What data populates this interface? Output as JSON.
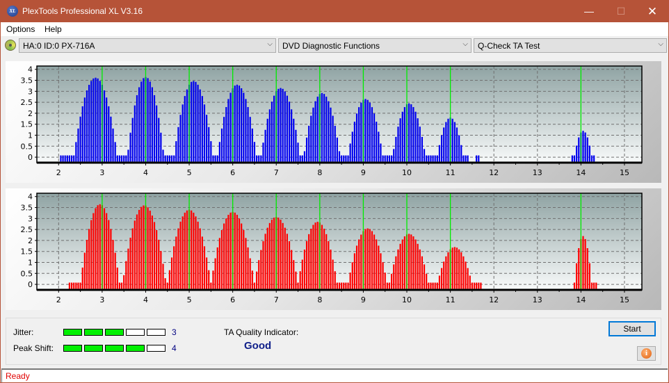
{
  "window": {
    "title": "PlexTools Professional XL V3.16",
    "app_icon_text": "XL",
    "controls": {
      "minimize": "—",
      "maximize": "☐",
      "close": "✕"
    }
  },
  "menu": {
    "items": [
      "Options",
      "Help"
    ]
  },
  "toolbar": {
    "drive": "HA:0 ID:0  PX-716A",
    "function_group": "DVD Diagnostic Functions",
    "test": "Q-Check TA Test",
    "arrow": "⌵"
  },
  "colors": {
    "titlebar": "#b65338",
    "jitter_bar": "#0000ee",
    "peak_shift_bar": "#ff0000",
    "marker_line": "#00ee00",
    "meter_on": "#00f000",
    "quality_text": "#10208a",
    "status_text": "#e00000"
  },
  "chart_data": [
    {
      "type": "bar",
      "name": "Jitter distribution (lands)",
      "color": "#0000ee",
      "xlim": [
        1.5,
        15.4
      ],
      "ylim": [
        -0.25,
        4.15
      ],
      "xticks": [
        2,
        3,
        4,
        5,
        6,
        7,
        8,
        9,
        10,
        11,
        12,
        13,
        14,
        15
      ],
      "yticks": [
        0,
        0.5,
        1,
        1.5,
        2,
        2.5,
        3,
        3.5,
        4
      ],
      "ytick_labels": [
        "0",
        "0.5",
        "1",
        "1.5",
        "2",
        "2.5",
        "3",
        "3.5",
        "4"
      ],
      "marker_lines": [
        3,
        4,
        5,
        6,
        7,
        8,
        9,
        10,
        11,
        14
      ],
      "grid": true,
      "peaks": [
        {
          "center": 2.85,
          "height": 3.62,
          "width": 0.5
        },
        {
          "center": 4.0,
          "height": 3.65,
          "width": 0.42
        },
        {
          "center": 5.1,
          "height": 3.47,
          "width": 0.45
        },
        {
          "center": 6.1,
          "height": 3.3,
          "width": 0.45
        },
        {
          "center": 7.1,
          "height": 3.15,
          "width": 0.45
        },
        {
          "center": 8.05,
          "height": 2.92,
          "width": 0.42
        },
        {
          "center": 9.05,
          "height": 2.65,
          "width": 0.4
        },
        {
          "center": 10.05,
          "height": 2.45,
          "width": 0.38
        },
        {
          "center": 11.0,
          "height": 1.8,
          "width": 0.3
        },
        {
          "center": 14.05,
          "height": 1.2,
          "width": 0.2
        }
      ],
      "x_range_with_bars": [
        [
          2.05,
          11.4
        ],
        [
          11.6,
          11.65
        ],
        [
          13.8,
          14.3
        ]
      ]
    },
    {
      "type": "bar",
      "name": "Peak shift distribution (pits)",
      "color": "#ff0000",
      "xlim": [
        1.5,
        15.4
      ],
      "ylim": [
        -0.25,
        4.15
      ],
      "xticks": [
        2,
        3,
        4,
        5,
        6,
        7,
        8,
        9,
        10,
        11,
        12,
        13,
        14,
        15
      ],
      "yticks": [
        0,
        0.5,
        1,
        1.5,
        2,
        2.5,
        3,
        3.5,
        4
      ],
      "ytick_labels": [
        "0",
        "0.5",
        "1",
        "1.5",
        "2",
        "2.5",
        "3",
        "3.5",
        "4"
      ],
      "marker_lines": [
        3,
        4,
        5,
        6,
        7,
        8,
        9,
        10,
        11,
        14
      ],
      "grid": true,
      "peaks": [
        {
          "center": 2.95,
          "height": 3.65,
          "width": 0.45
        },
        {
          "center": 3.97,
          "height": 3.6,
          "width": 0.5
        },
        {
          "center": 5.0,
          "height": 3.4,
          "width": 0.5
        },
        {
          "center": 6.0,
          "height": 3.3,
          "width": 0.5
        },
        {
          "center": 7.0,
          "height": 3.07,
          "width": 0.5
        },
        {
          "center": 7.95,
          "height": 2.85,
          "width": 0.45
        },
        {
          "center": 9.1,
          "height": 2.55,
          "width": 0.45
        },
        {
          "center": 10.05,
          "height": 2.3,
          "width": 0.45
        },
        {
          "center": 11.1,
          "height": 1.7,
          "width": 0.4
        },
        {
          "center": 14.05,
          "height": 2.2,
          "width": 0.2
        }
      ],
      "x_range_with_bars": [
        [
          2.25,
          11.7
        ],
        [
          13.85,
          14.35
        ]
      ]
    }
  ],
  "metrics": {
    "jitter": {
      "label": "Jitter:",
      "value": "3",
      "level": 3,
      "max": 5
    },
    "peak_shift": {
      "label": "Peak Shift:",
      "value": "4",
      "level": 4,
      "max": 5
    },
    "ta_quality_label": "TA Quality Indicator:",
    "ta_quality_value": "Good"
  },
  "buttons": {
    "start": "Start",
    "info_icon": "i"
  },
  "status": {
    "text": "Ready"
  }
}
